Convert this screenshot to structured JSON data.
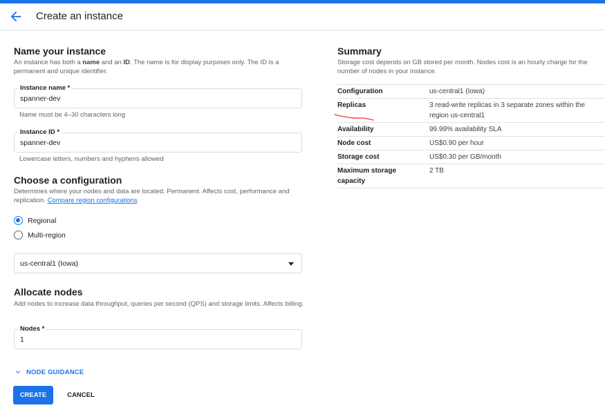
{
  "header": {
    "title": "Create an instance"
  },
  "name_section": {
    "title": "Name your instance",
    "description_parts": [
      "An instance has both a ",
      "name",
      " and an ",
      "ID",
      ". The name is for display purposes only. The ID is a permanent and unique identifier."
    ],
    "instance_name": {
      "label": "Instance name *",
      "value": "spanner-dev",
      "hint": "Name must be 4–30 characters long"
    },
    "instance_id": {
      "label": "Instance ID *",
      "value": "spanner-dev",
      "hint": "Lowercase letters, numbers and hyphens allowed"
    }
  },
  "config_section": {
    "title": "Choose a configuration",
    "description": "Determines where your nodes and data are located. Permanent. Affects cost, performance and replication.",
    "link": "Compare region configurations",
    "options": [
      {
        "label": "Regional",
        "checked": true
      },
      {
        "label": "Multi-region",
        "checked": false
      }
    ],
    "selected_region": "us-central1 (Iowa)"
  },
  "nodes_section": {
    "title": "Allocate nodes",
    "description": "Add nodes to increase data throughput, queries per second (QPS) and storage limits. Affects billing.",
    "nodes": {
      "label": "Nodes *",
      "value": "1"
    },
    "guidance": "NODE GUIDANCE"
  },
  "actions": {
    "create": "CREATE",
    "cancel": "CANCEL"
  },
  "summary": {
    "title": "Summary",
    "description": "Storage cost depends on GB stored per month. Nodes cost is an hourly charge for the number of nodes in your instance.",
    "rows": [
      {
        "key": "Configuration",
        "value": "us-central1 (Iowa)"
      },
      {
        "key": "Replicas",
        "value": "3 read-write replicas in 3 separate zones within the region us-central1"
      },
      {
        "key": "Availability",
        "value": "99.99% availability SLA"
      },
      {
        "key": "Node cost",
        "value": "US$0.90 per hour"
      },
      {
        "key": "Storage cost",
        "value": "US$0.30 per GB/month"
      },
      {
        "key": "Maximum storage capacity",
        "value": "2 TB"
      }
    ]
  },
  "colors": {
    "accent": "#1a73e8",
    "annotation": "#e53935"
  },
  "icons": {
    "back": "arrow-back-icon",
    "expand": "chevron-down-icon",
    "dropdown": "caret-down-icon"
  }
}
